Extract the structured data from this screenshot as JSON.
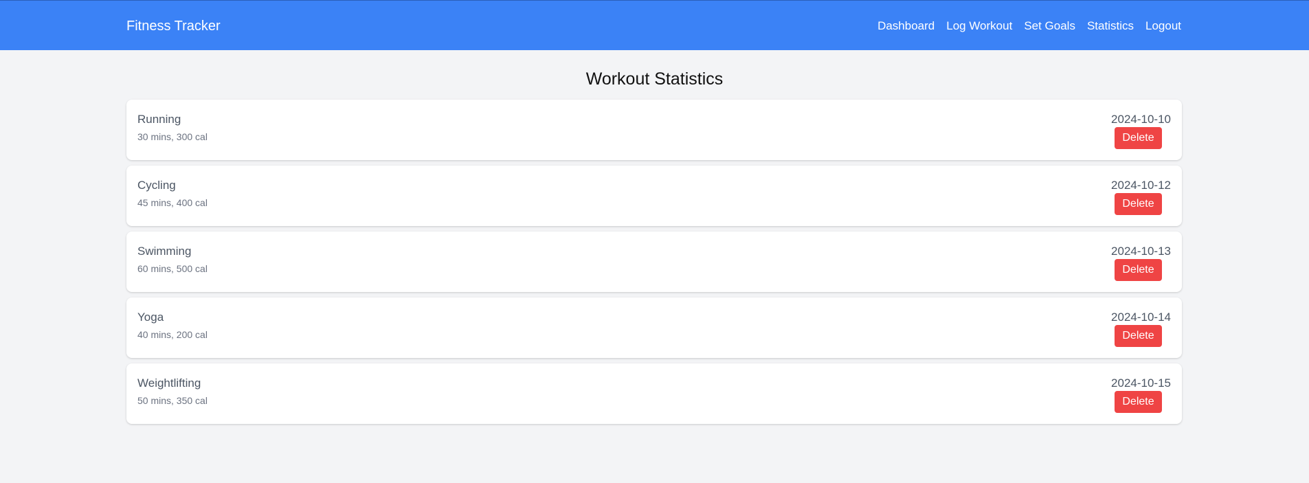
{
  "app": {
    "brand": "Fitness Tracker"
  },
  "nav": {
    "items": [
      {
        "label": "Dashboard"
      },
      {
        "label": "Log Workout"
      },
      {
        "label": "Set Goals"
      },
      {
        "label": "Statistics"
      },
      {
        "label": "Logout"
      }
    ]
  },
  "main": {
    "title": "Workout Statistics",
    "delete_label": "Delete",
    "workouts": [
      {
        "name": "Running",
        "detail": "30 mins, 300 cal",
        "date": "2024-10-10"
      },
      {
        "name": "Cycling",
        "detail": "45 mins, 400 cal",
        "date": "2024-10-12"
      },
      {
        "name": "Swimming",
        "detail": "60 mins, 500 cal",
        "date": "2024-10-13"
      },
      {
        "name": "Yoga",
        "detail": "40 mins, 200 cal",
        "date": "2024-10-14"
      },
      {
        "name": "Weightlifting",
        "detail": "50 mins, 350 cal",
        "date": "2024-10-15"
      }
    ]
  },
  "colors": {
    "navbar": "#3b82f6",
    "background": "#f3f4f6",
    "delete_button": "#ef4444"
  }
}
